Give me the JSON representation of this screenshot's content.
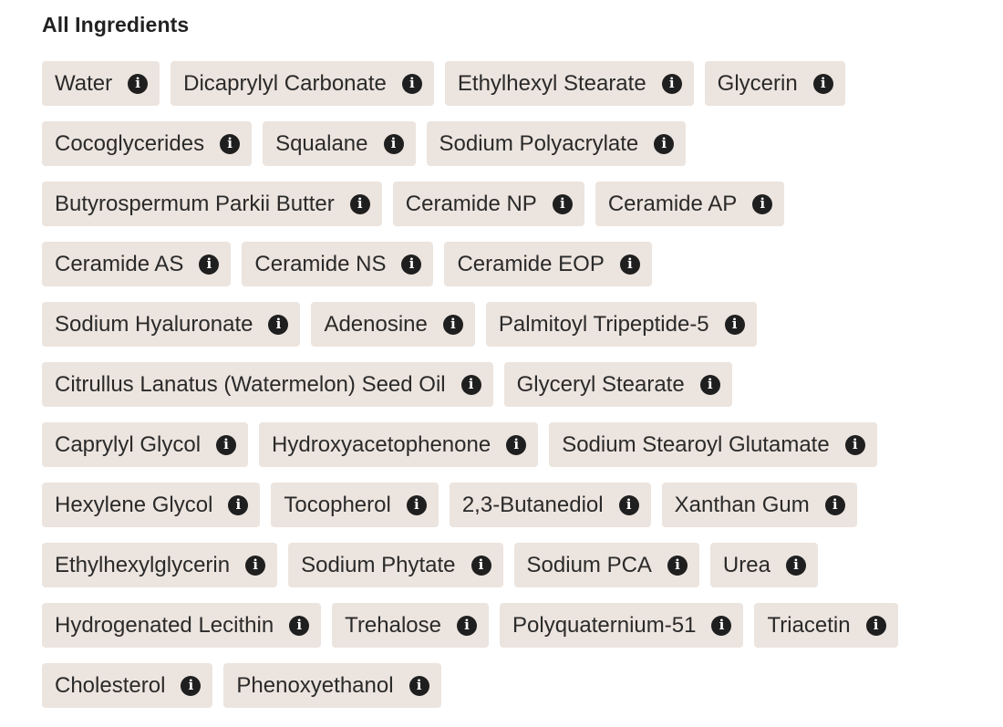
{
  "section": {
    "title": "All Ingredients"
  },
  "ingredients": [
    [
      "Water",
      "Dicaprylyl Carbonate",
      "Ethylhexyl Stearate",
      "Glycerin"
    ],
    [
      "Cocoglycerides",
      "Squalane",
      "Sodium Polyacrylate"
    ],
    [
      "Butyrospermum Parkii Butter",
      "Ceramide NP",
      "Ceramide AP"
    ],
    [
      "Ceramide AS",
      "Ceramide NS",
      "Ceramide EOP"
    ],
    [
      "Sodium Hyaluronate",
      "Adenosine",
      "Palmitoyl Tripeptide-5"
    ],
    [
      "Citrullus Lanatus (Watermelon) Seed Oil",
      "Glyceryl Stearate"
    ],
    [
      "Caprylyl Glycol",
      "Hydroxyacetophenone",
      "Sodium Stearoyl Glutamate"
    ],
    [
      "Hexylene Glycol",
      "Tocopherol",
      "2,3-Butanediol",
      "Xanthan Gum"
    ],
    [
      "Ethylhexylglycerin",
      "Sodium Phytate",
      "Sodium PCA",
      "Urea"
    ],
    [
      "Hydrogenated Lecithin",
      "Trehalose",
      "Polyquaternium-51",
      "Triacetin"
    ],
    [
      "Cholesterol",
      "Phenoxyethanol"
    ]
  ],
  "info_icon": {
    "name": "info-icon",
    "glyph": "i"
  },
  "colors": {
    "chip_background": "#ece4de",
    "icon_background": "#1f1f1f",
    "text": "#2a2a2a"
  }
}
